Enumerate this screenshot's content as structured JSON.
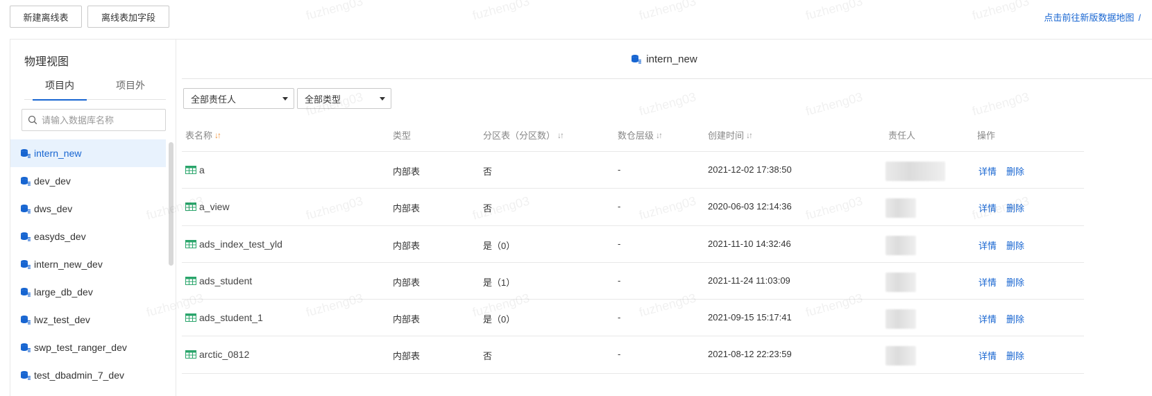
{
  "toolbar": {
    "new_table_label": "新建离线表",
    "add_field_label": "离线表加字段",
    "new_map_link": "点击前往新版数据地图",
    "link_separator": "/"
  },
  "sidebar": {
    "title": "物理视图",
    "tabs": [
      "项目内",
      "项目外"
    ],
    "search_placeholder": "请输入数据库名称",
    "databases": [
      "intern_new",
      "dev_dev",
      "dws_dev",
      "easyds_dev",
      "intern_new_dev",
      "large_db_dev",
      "lwz_test_dev",
      "swp_test_ranger_dev",
      "test_dbadmin_7_dev"
    ],
    "active_index": 0
  },
  "main": {
    "title": "intern_new",
    "filters": {
      "owner": "全部责任人",
      "type": "全部类型"
    },
    "columns": [
      "表名称",
      "类型",
      "分区表（分区数）",
      "数仓层级",
      "创建时间",
      "责任人",
      "操作"
    ],
    "actions": [
      "详情",
      "删除"
    ],
    "rows": [
      {
        "name": "a",
        "type": "内部表",
        "partition": "否",
        "layer": "-",
        "created": "2021-12-02 17:38:50"
      },
      {
        "name": "a_view",
        "type": "内部表",
        "partition": "否",
        "layer": "-",
        "created": "2020-06-03 12:14:36"
      },
      {
        "name": "ads_index_test_yld",
        "type": "内部表",
        "partition": "是（0）",
        "layer": "-",
        "created": "2021-11-10 14:32:46"
      },
      {
        "name": "ads_student",
        "type": "内部表",
        "partition": "是（1）",
        "layer": "-",
        "created": "2021-11-24 11:03:09"
      },
      {
        "name": "ads_student_1",
        "type": "内部表",
        "partition": "是（0）",
        "layer": "-",
        "created": "2021-09-15 15:17:41"
      },
      {
        "name": "arctic_0812",
        "type": "内部表",
        "partition": "否",
        "layer": "-",
        "created": "2021-08-12 22:23:59"
      }
    ]
  },
  "watermark": "fuzheng03",
  "colors": {
    "accent": "#1765d1",
    "active_bg": "#e8f2fd",
    "table_icon": "#2aa56b",
    "sort_active": "#f08c2e"
  }
}
